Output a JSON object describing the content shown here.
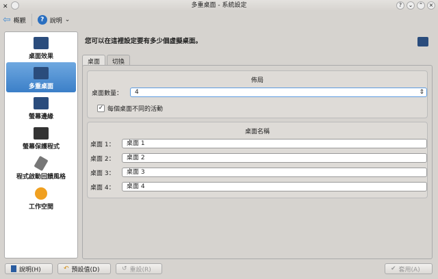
{
  "window": {
    "title": "多重桌面 - 系統設定"
  },
  "toolbar": {
    "overview": "概觀",
    "help": "說明"
  },
  "sidebar": {
    "items": [
      {
        "label": "桌面效果",
        "active": false
      },
      {
        "label": "多重桌面",
        "active": true
      },
      {
        "label": "螢幕邊緣",
        "active": false
      },
      {
        "label": "螢幕保護程式",
        "active": false
      },
      {
        "label": "程式啟動回饋風格",
        "active": false
      },
      {
        "label": "工作空間",
        "active": false
      }
    ]
  },
  "main": {
    "description": "您可以在這裡設定要有多少個虛擬桌面。",
    "tabs": [
      "桌面",
      "切換"
    ],
    "layout": {
      "title": "佈局",
      "count_label": "桌面數量：",
      "count_value": "4",
      "different_activity_label": "每個桌面不同的活動",
      "different_activity_checked": true
    },
    "names": {
      "title": "桌面名稱",
      "rows": [
        {
          "label": "桌面 1：",
          "value": "桌面 1"
        },
        {
          "label": "桌面 2：",
          "value": "桌面 2"
        },
        {
          "label": "桌面 3：",
          "value": "桌面 3"
        },
        {
          "label": "桌面 4：",
          "value": "桌面 4"
        }
      ]
    }
  },
  "buttons": {
    "help": "說明(H)",
    "defaults": "預設值(D)",
    "reset": "重設(R)",
    "apply": "套用(A)"
  }
}
